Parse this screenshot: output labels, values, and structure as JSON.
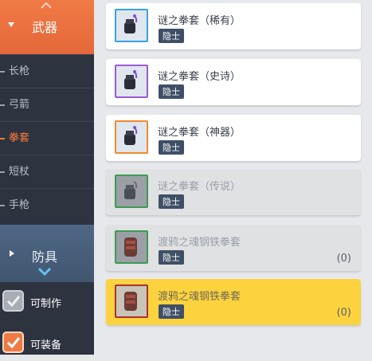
{
  "sidebar": {
    "weapon_category": "武器",
    "weapon_items": [
      {
        "label": "长枪",
        "active": false
      },
      {
        "label": "弓箭",
        "active": false
      },
      {
        "label": "拳套",
        "active": true
      },
      {
        "label": "短杖",
        "active": false
      },
      {
        "label": "手枪",
        "active": false
      }
    ],
    "armor_category": "防具",
    "filters": [
      {
        "label": "可制作",
        "checked": false
      },
      {
        "label": "可装备",
        "checked": true
      }
    ]
  },
  "items": [
    {
      "name": "谜之拳套（稀有）",
      "tag": "隐士",
      "count": "",
      "state": "normal",
      "frame_color": "#3ba0ea",
      "icon": "blue-gauntlet-icon"
    },
    {
      "name": "谜之拳套（史诗）",
      "tag": "隐士",
      "count": "",
      "state": "normal",
      "frame_color": "#9b59d6",
      "icon": "purple-gauntlet-icon"
    },
    {
      "name": "谜之拳套（神器）",
      "tag": "隐士",
      "count": "",
      "state": "normal",
      "frame_color": "#f08a30",
      "icon": "orange-gauntlet-icon"
    },
    {
      "name": "谜之拳套（传说）",
      "tag": "隐士",
      "count": "",
      "state": "dim",
      "frame_color": "#3e9a52",
      "icon": "gray-gauntlet-icon"
    },
    {
      "name": "渡鸦之魂钢铁拳套",
      "tag": "隐士",
      "count": "(0)",
      "state": "dim",
      "frame_color": "#3e9a52",
      "icon": "red-gauntlet-icon"
    },
    {
      "name": "渡鸦之魂钢铁拳套",
      "tag": "隐士",
      "count": "(0)",
      "state": "selected",
      "frame_color": "#b03030",
      "icon": "red-gauntlet-icon"
    }
  ]
}
